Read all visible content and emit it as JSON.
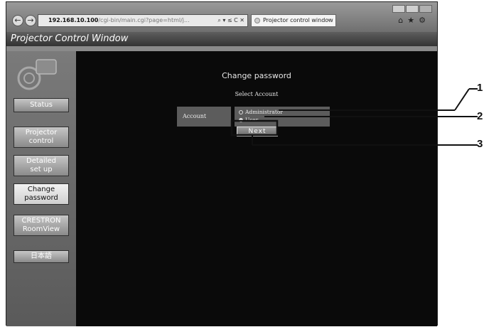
{
  "browser": {
    "url_host": "192.168.10.100",
    "url_rest": "/cgi-bin/main.cgi?page=html/j...",
    "address_tools": "⌕ ▾ ≤ C ✕",
    "tab_title": "Projector control window",
    "tab_close": "×",
    "back_icon": "←",
    "forward_icon": "→",
    "right_icons": "⌂★⚙"
  },
  "window": {
    "title": "Projector Control Window"
  },
  "sidebar": {
    "items": [
      {
        "label": "Status",
        "active": false
      },
      {
        "label": "Projector\ncontrol",
        "active": false
      },
      {
        "label": "Detailed\nset up",
        "active": false
      },
      {
        "label": "Change\npassword",
        "active": true
      },
      {
        "label": "CRESTRON\nRoomView",
        "active": false
      },
      {
        "label": "日本語",
        "active": false
      }
    ]
  },
  "main": {
    "title": "Change password",
    "section_title": "Select Account",
    "account_label": "Account",
    "options": [
      {
        "label": "Administrator",
        "selected": false
      },
      {
        "label": "User",
        "selected": true
      }
    ],
    "next_label": "Next"
  },
  "callouts": [
    "1",
    "2",
    "3"
  ]
}
